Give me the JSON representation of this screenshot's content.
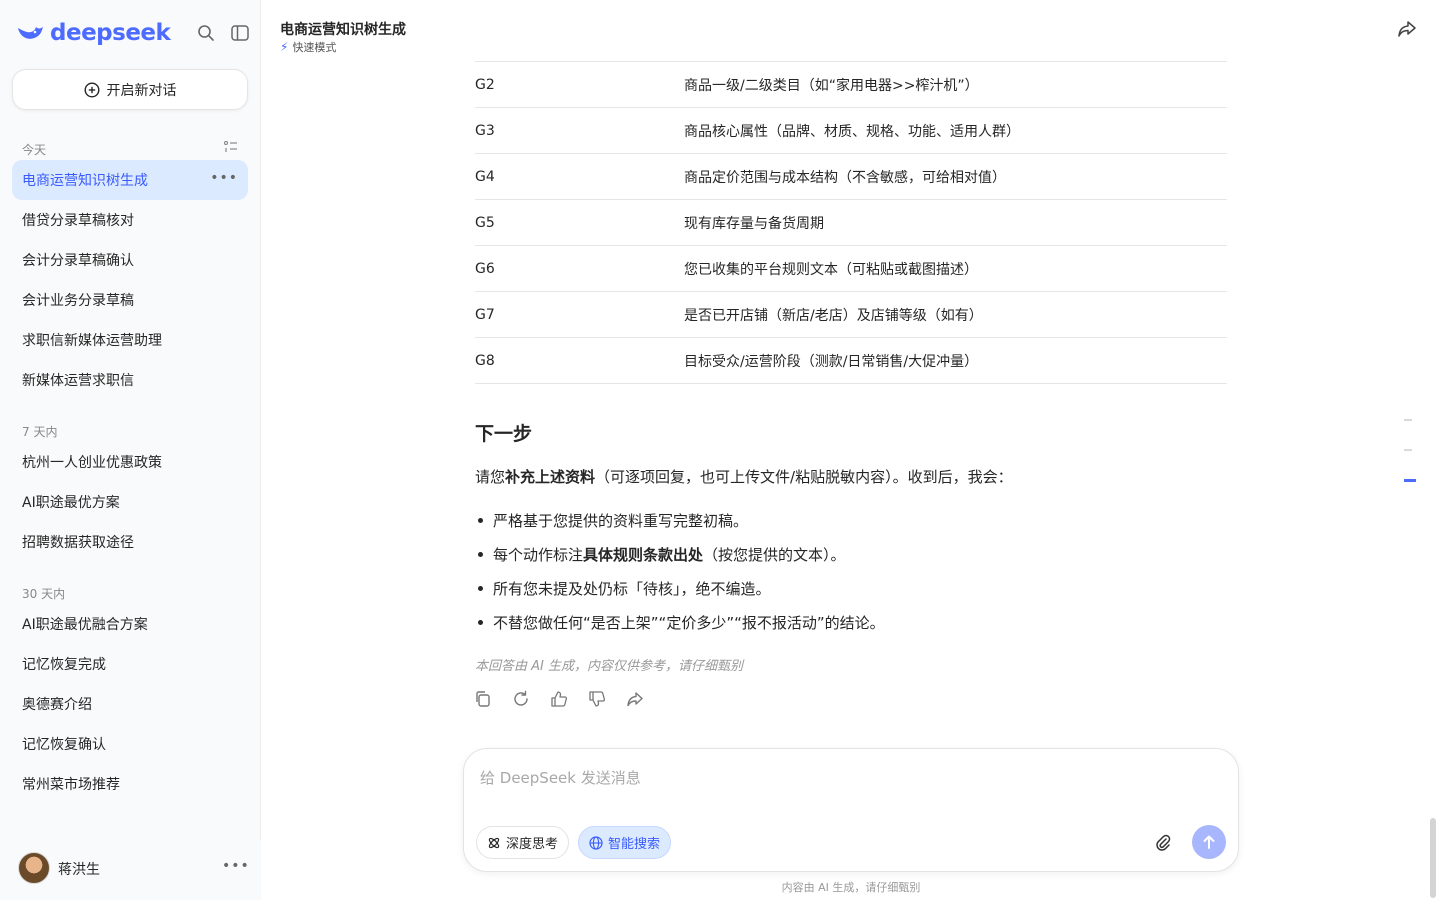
{
  "brand": {
    "name": "deepseek",
    "color": "#4d6bfe"
  },
  "sidebar": {
    "new_chat": "开启新对话",
    "groups": [
      {
        "label": "今天",
        "items": [
          "电商运营知识树生成",
          "借贷分录草稿核对",
          "会计分录草稿确认",
          "会计业务分录草稿",
          "求职信新媒体运营助理",
          "新媒体运营求职信"
        ]
      },
      {
        "label": "7 天内",
        "items": [
          "杭州一人创业优惠政策",
          "AI职途最优方案",
          "招聘数据获取途径"
        ]
      },
      {
        "label": "30 天内",
        "items": [
          "AI职途最优融合方案",
          "记忆恢复完成",
          "奥德赛介绍",
          "记忆恢复确认",
          "常州菜市场推荐"
        ]
      }
    ],
    "active_item": "电商运营知识树生成",
    "user": {
      "name": "蒋洪生"
    }
  },
  "header": {
    "title": "电商运营知识树生成",
    "mode": "快速模式"
  },
  "table": {
    "rows": [
      [
        "G2",
        "商品一级/二级类目（如“家用电器>>榨汁机”）"
      ],
      [
        "G3",
        "商品核心属性（品牌、材质、规格、功能、适用人群）"
      ],
      [
        "G4",
        "商品定价范围与成本结构（不含敏感，可给相对值）"
      ],
      [
        "G5",
        "现有库存量与备货周期"
      ],
      [
        "G6",
        "您已收集的平台规则文本（可粘贴或截图描述）"
      ],
      [
        "G7",
        "是否已开店铺（新店/老店）及店铺等级（如有）"
      ],
      [
        "G8",
        "目标受众/运营阶段（测款/日常销售/大促冲量）"
      ]
    ]
  },
  "content": {
    "next_heading": "下一步",
    "para_pre": "请您",
    "para_bold": "补充上述资料",
    "para_post": "（可逐项回复，也可上传文件/粘贴脱敏内容）。收到后，我会：",
    "bullets": [
      {
        "pre": "严格基于您提供的资料重写完整初稿。",
        "bold": "",
        "post": ""
      },
      {
        "pre": "每个动作标注",
        "bold": "具体规则条款出处",
        "post": "（按您提供的文本）。"
      },
      {
        "pre": "所有您未提及处仍标「待核」，绝不编造。",
        "bold": "",
        "post": ""
      },
      {
        "pre": "不替您做任何“是否上架”“定价多少”“报不报活动”的结论。",
        "bold": "",
        "post": ""
      }
    ],
    "disclaimer": "本回答由 AI 生成，内容仅供参考，请仔细甄别"
  },
  "composer": {
    "placeholder": "给 DeepSeek 发送消息",
    "deep_think": "深度思考",
    "smart_search": "智能搜索"
  },
  "footer_note": "内容由 AI 生成，请仔细甄别"
}
